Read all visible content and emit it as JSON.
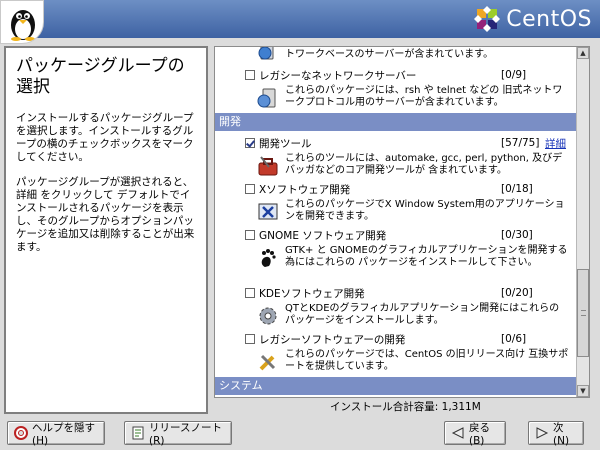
{
  "header": {
    "brand": "CentOS"
  },
  "help": {
    "title": "パッケージグループの選択",
    "paragraphs": [
      "インストールするパッケージグループを選択します。インストールするグループの横のチェックボックスをマークしてください。",
      "パッケージグループが選択されると、詳細 をクリックして デフォルトでインストールされるパッケージを表示し、そのグループからオプションパッケージを追加又は削除することが出来ます。"
    ]
  },
  "list": {
    "top_partial": {
      "desc": "これらのパッケージには、DHCP、Kerberos、NIS などのネットワークベースのサーバーが含まれています。"
    },
    "legacy_net": {
      "name": "レガシーなネットワークサーバー",
      "count": "[0/9]",
      "desc": "これらのパッケージには、rsh や telnet などの 旧式ネットワークプロトコル用のサーバーが含まれています。"
    },
    "category_dev": "開発",
    "dev_tools": {
      "name": "開発ツール",
      "count": "[57/75]",
      "detail": "詳細",
      "checked": true,
      "desc": "これらのツールには、automake, gcc, perl, python, 及びデバッガなどのコア開発ツールが 含まれています。"
    },
    "x_dev": {
      "name": "Xソフトウェア開発",
      "count": "[0/18]",
      "desc": "これらのパッケージでX Window System用のアプリケーションを開発できます。"
    },
    "gnome_dev": {
      "name": "GNOME ソフトウェア開発",
      "count": "[0/30]",
      "desc": "GTK+ と GNOMEのグラフィカルアプリケーションを開発する為にはこれらの パッケージをインストールして下さい。"
    },
    "kde_dev": {
      "name": "KDEソフトウェア開発",
      "count": "[0/20]",
      "desc": "QTとKDEのグラフィカルアプリケーション開発にはこれらのパッケージをインストールします。"
    },
    "legacy_dev": {
      "name": "レガシーソフトウェアーの開発",
      "count": "[0/6]",
      "desc": "これらのパッケージでは、CentOS の旧リリース向け 互換サポートを提供しています。"
    },
    "category_system": "システム"
  },
  "install_size": "インストール合計容量: 1,311M",
  "buttons": {
    "hide_help": "ヘルプを隠す(H)",
    "release_notes": "リリースノート(R)",
    "back": "戻る(B)",
    "next": "次(N)"
  }
}
